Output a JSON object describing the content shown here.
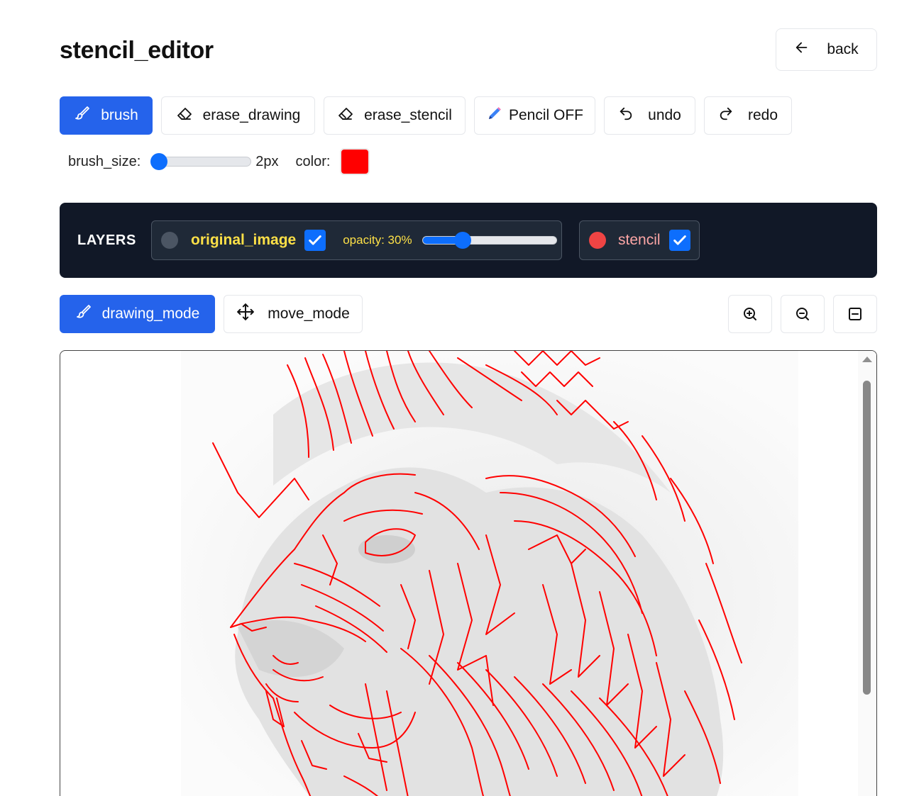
{
  "header": {
    "title": "stencil_editor",
    "back_label": "back"
  },
  "toolbar": {
    "brush": "brush",
    "erase_drawing": "erase_drawing",
    "erase_stencil": "erase_stencil",
    "pencil": "Pencil OFF",
    "undo": "undo",
    "redo": "redo"
  },
  "brush_settings": {
    "size_label": "brush_size:",
    "size_value": "2px",
    "size_fraction": 0.06,
    "color_label": "color:",
    "color": "#ff0000"
  },
  "layers": {
    "title": "LAYERS",
    "original": {
      "label": "original_image",
      "checked": true,
      "opacity_label": "opacity: 30%",
      "opacity": 0.3,
      "dot_color": "#4b5563",
      "label_color": "#fde047"
    },
    "stencil": {
      "label": "stencil",
      "checked": true,
      "dot_color": "#ef4444",
      "label_color": "#fca5a5"
    }
  },
  "modes": {
    "drawing": "drawing_mode",
    "move": "move_mode"
  },
  "colors": {
    "accent": "#2563eb",
    "panel": "#111827",
    "stencil_line": "#ff0000"
  }
}
